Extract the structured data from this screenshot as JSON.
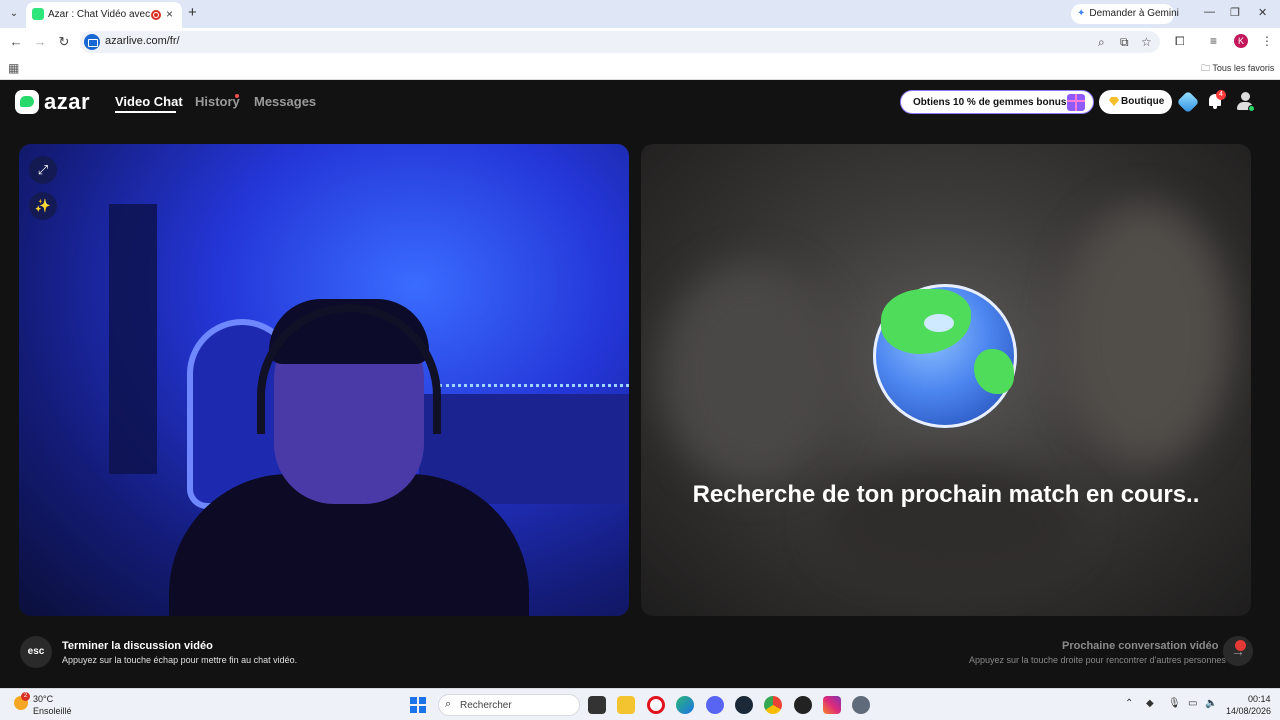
{
  "browser": {
    "tab_title": "Azar : Chat Vidéo avec de n",
    "gemini_label": "Demander à Gemini",
    "url": "azarlive.com/fr/",
    "bookmarks_all": "Tous les favoris",
    "profile_initial": "K"
  },
  "header": {
    "logo_text": "azar",
    "nav": [
      {
        "label": "Video Chat",
        "active": true
      },
      {
        "label": "History",
        "active": false,
        "has_dot": true
      },
      {
        "label": "Messages",
        "active": false
      }
    ],
    "promo_label": "Obtiens 10 % de gemmes bonus !",
    "boutique_label": "Boutique",
    "notification_count": "4"
  },
  "match": {
    "searching_text": "Recherche de ton prochain match en cours.."
  },
  "footer": {
    "esc_key": "esc",
    "end_title": "Terminer la discussion vidéo",
    "end_desc": "Appuyez sur la touche échap pour mettre fin au chat vidéo.",
    "next_title": "Prochaine conversation vidéo",
    "next_desc": "Appuyez sur la touche droite pour rencontrer d'autres personnes",
    "next_key": "→"
  },
  "taskbar": {
    "weather_temp": "30°C",
    "weather_desc": "Ensoleillé",
    "weather_badge": "2",
    "search_placeholder": "Rechercher",
    "time": "00:14",
    "date": "14/08/2026"
  },
  "colors": {
    "brand_green": "#27d96b",
    "page_bg": "#121212",
    "accent_purple": "#8f5bff"
  }
}
